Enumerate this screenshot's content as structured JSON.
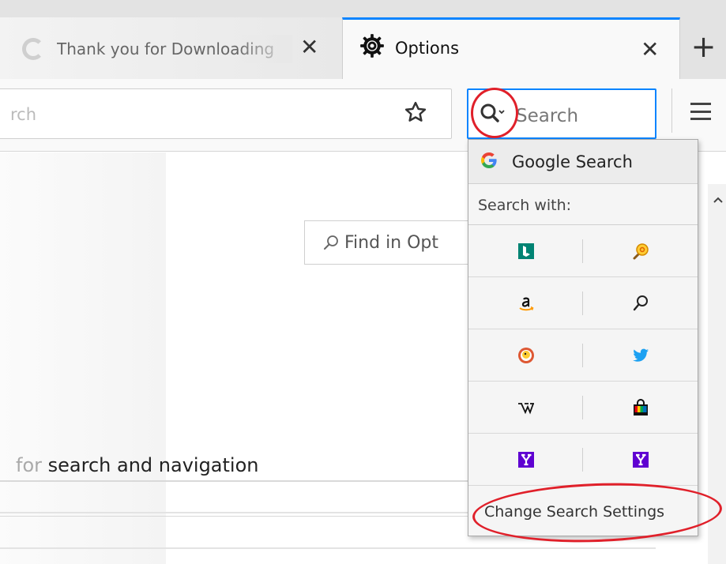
{
  "tabs": [
    {
      "label": "Thank you for Downloading",
      "active": false
    },
    {
      "label": "Options",
      "active": true
    }
  ],
  "icons": {
    "close": "close-icon",
    "new_tab": "plus-icon",
    "gear": "gear-icon",
    "star": "star-icon",
    "menu": "hamburger-icon"
  },
  "close_glyph": "✕",
  "new_tab_glyph": "+",
  "urlbar": {
    "placeholder": "rch"
  },
  "search": {
    "placeholder": "Search"
  },
  "find": {
    "placeholder": "Find in Opt"
  },
  "section": {
    "dim_text": "for ",
    "text": "search and navigation"
  },
  "popup": {
    "default_engine": "Google Search",
    "search_with_label": "Search with:",
    "engines": [
      [
        "bing",
        "mail.ru"
      ],
      [
        "amazon",
        "search"
      ],
      [
        "duckduckgo",
        "twitter"
      ],
      [
        "wikipedia",
        "shopping"
      ],
      [
        "yahoo",
        "yahoo"
      ]
    ],
    "change_settings": "Change Search Settings"
  },
  "colors": {
    "accent": "#0a84ff",
    "annotation": "#e0202a"
  }
}
